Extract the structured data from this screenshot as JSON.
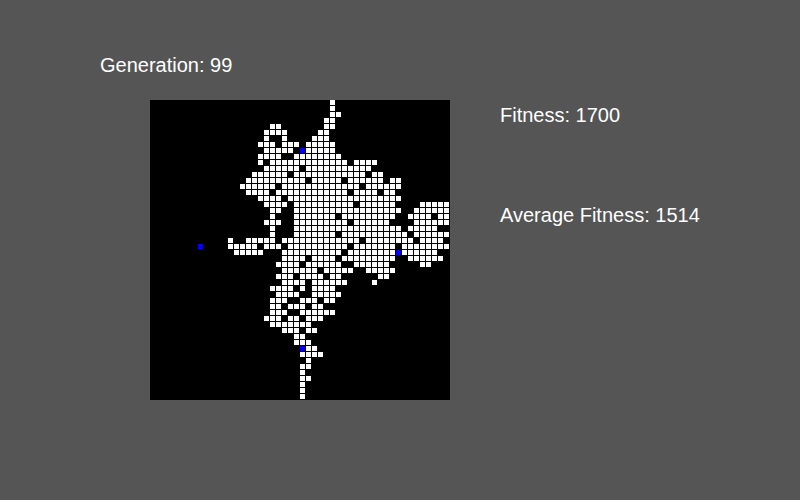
{
  "header": {
    "generation": "Generation: 99"
  },
  "stats": {
    "fitness": "Fitness: 1700",
    "average_fitness": "Average Fitness: 1514"
  },
  "grid": {
    "white_runs": [
      [
        [
          30,
          30
        ]
      ],
      [
        [
          30,
          30
        ]
      ],
      [
        [
          30,
          31
        ]
      ],
      [
        [
          29,
          30
        ]
      ],
      [
        [
          20,
          21
        ],
        [
          29,
          30
        ]
      ],
      [
        [
          19,
          22
        ],
        [
          28,
          29
        ]
      ],
      [
        [
          19,
          19
        ],
        [
          22,
          22
        ],
        [
          27,
          29
        ]
      ],
      [
        [
          18,
          20
        ],
        [
          22,
          24
        ],
        [
          26,
          30
        ]
      ],
      [
        [
          19,
          23
        ],
        [
          26,
          30
        ]
      ],
      [
        [
          18,
          21
        ],
        [
          24,
          31
        ]
      ],
      [
        [
          18,
          18
        ],
        [
          20,
          32
        ],
        [
          34,
          37
        ]
      ],
      [
        [
          19,
          24
        ],
        [
          26,
          36
        ]
      ],
      [
        [
          17,
          22
        ],
        [
          24,
          35
        ],
        [
          37,
          38
        ]
      ],
      [
        [
          16,
          25
        ],
        [
          27,
          31
        ],
        [
          33,
          38
        ],
        [
          40,
          41
        ]
      ],
      [
        [
          15,
          20
        ],
        [
          22,
          34
        ],
        [
          36,
          41
        ]
      ],
      [
        [
          16,
          19
        ],
        [
          21,
          32
        ],
        [
          34,
          37
        ],
        [
          39,
          40
        ]
      ],
      [
        [
          18,
          21
        ],
        [
          23,
          41
        ]
      ],
      [
        [
          19,
          22
        ],
        [
          24,
          33
        ],
        [
          35,
          40
        ],
        [
          45,
          49
        ]
      ],
      [
        [
          20,
          21
        ],
        [
          24,
          41
        ],
        [
          44,
          49
        ]
      ],
      [
        [
          20,
          20
        ],
        [
          24,
          30
        ],
        [
          32,
          40
        ],
        [
          43,
          46
        ],
        [
          48,
          49
        ]
      ],
      [
        [
          19,
          21
        ],
        [
          24,
          32
        ],
        [
          34,
          39
        ],
        [
          44,
          49
        ]
      ],
      [
        [
          20,
          20
        ],
        [
          24,
          41
        ],
        [
          43,
          47
        ]
      ],
      [
        [
          20,
          20
        ],
        [
          24,
          30
        ],
        [
          32,
          42
        ],
        [
          44,
          49
        ]
      ],
      [
        [
          13,
          13
        ],
        [
          16,
          20
        ],
        [
          22,
          34
        ],
        [
          36,
          43
        ],
        [
          45,
          48
        ]
      ],
      [
        [
          13,
          17
        ],
        [
          19,
          21
        ],
        [
          23,
          32
        ],
        [
          34,
          40
        ],
        [
          42,
          49
        ]
      ],
      [
        [
          14,
          18
        ],
        [
          22,
          31
        ],
        [
          33,
          40
        ],
        [
          42,
          47
        ]
      ],
      [
        [
          22,
          25
        ],
        [
          27,
          30
        ],
        [
          32,
          40
        ],
        [
          43,
          48
        ]
      ],
      [
        [
          21,
          24
        ],
        [
          26,
          31
        ],
        [
          34,
          39
        ],
        [
          45,
          46
        ]
      ],
      [
        [
          22,
          27
        ],
        [
          29,
          33
        ],
        [
          36,
          40
        ]
      ],
      [
        [
          21,
          23
        ],
        [
          25,
          28
        ],
        [
          30,
          31
        ],
        [
          38,
          39
        ]
      ],
      [
        [
          22,
          25
        ],
        [
          27,
          32
        ],
        [
          37,
          37
        ]
      ],
      [
        [
          20,
          23
        ],
        [
          25,
          25
        ],
        [
          27,
          30
        ]
      ],
      [
        [
          21,
          24
        ],
        [
          27,
          31
        ]
      ],
      [
        [
          20,
          22
        ],
        [
          25,
          27
        ],
        [
          29,
          30
        ]
      ],
      [
        [
          20,
          21
        ],
        [
          23,
          25
        ],
        [
          27,
          28
        ]
      ],
      [
        [
          20,
          22
        ],
        [
          25,
          30
        ]
      ],
      [
        [
          19,
          21
        ],
        [
          23,
          24
        ],
        [
          26,
          28
        ]
      ],
      [
        [
          20,
          26
        ]
      ],
      [
        [
          22,
          24
        ],
        [
          26,
          27
        ]
      ],
      [
        [
          24,
          25
        ]
      ],
      [
        [
          24,
          26
        ]
      ],
      [
        [
          26,
          27
        ]
      ],
      [
        [
          25,
          28
        ]
      ],
      [
        [
          26,
          26
        ]
      ],
      [
        [
          25,
          26
        ]
      ],
      [
        [
          25,
          25
        ]
      ],
      [
        [
          25,
          26
        ]
      ],
      [
        [
          25,
          25
        ]
      ],
      [
        [
          25,
          25
        ]
      ],
      [
        [
          25,
          25
        ]
      ]
    ],
    "targets": [
      {
        "row": 8,
        "col": 25
      },
      {
        "row": 24,
        "col": 8
      },
      {
        "row": 25,
        "col": 41
      },
      {
        "row": 41,
        "col": 25
      }
    ]
  }
}
